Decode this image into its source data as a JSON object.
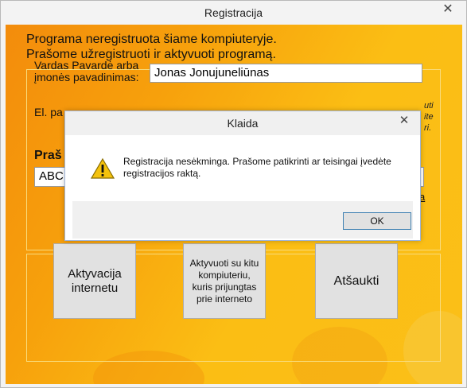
{
  "window": {
    "title": "Registracija",
    "close_glyph": "✕"
  },
  "intro": {
    "line1": "Programa neregistruota šiame kompiuteryje.",
    "line2": "Prašome užregistruoti ir aktyvuoti programą."
  },
  "form": {
    "name_label": "Vardas Pavardė arba įmonės pavadinimas:",
    "name_value": "Jonas Jonujuneliūnas",
    "email_label": "El. pa",
    "key_label": "Praš",
    "key_value": "ABC",
    "hint_text": "uti ite ri.",
    "link_text": "a"
  },
  "buttons": {
    "internet": "Aktyvacija internetu",
    "other_pc": "Aktyvuoti su kitu kompiuteriu, kuris prijungtas prie interneto",
    "cancel": "Atšaukti"
  },
  "dialog": {
    "title": "Klaida",
    "close_glyph": "✕",
    "icon": "warning-icon",
    "message": "Registracija nesėkminga. Prašome patikrinti ar teisingai įvedėte registracijos raktą.",
    "ok_label": "OK"
  },
  "colors": {
    "background_orange": "#f38c0c",
    "background_yellow": "#fbbf18",
    "panel_border": "#f9dc7c",
    "ok_border": "#3c7fb1"
  }
}
